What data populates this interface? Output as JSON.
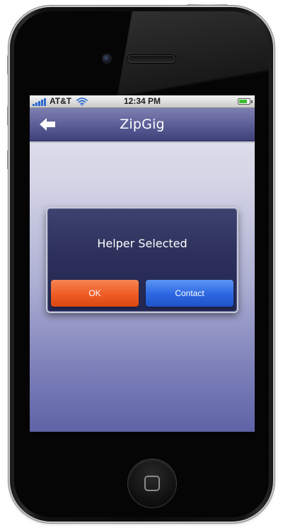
{
  "status_bar": {
    "carrier": "AT&T",
    "time": "12:34 PM",
    "signal_icon": "cellular-signal-icon",
    "wifi_icon": "wifi-icon",
    "battery_icon": "battery-icon",
    "battery_level": 0.8,
    "battery_color": "#3bbf2b"
  },
  "nav": {
    "title": "ZipGig",
    "back_icon": "back-arrow-icon"
  },
  "dialog": {
    "message": "Helper Selected",
    "ok_label": "OK",
    "contact_label": "Contact",
    "ok_color": "#ef5c26",
    "contact_color": "#2b66e2"
  },
  "device": {
    "home_icon": "home-button-icon"
  }
}
